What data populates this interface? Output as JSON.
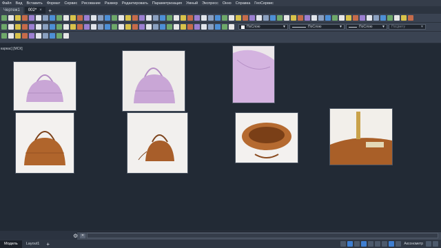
{
  "menubar": {
    "items": [
      "Файл",
      "Вид",
      "Вставить",
      "Формат",
      "Сервис",
      "Рисование",
      "Размер",
      "Редактировать",
      "Параметризация",
      "Умный",
      "Экспресс",
      "Окно",
      "Справка",
      "ГеоСервис"
    ]
  },
  "tabs": [
    {
      "label": "Чертеж1",
      "active": false
    },
    {
      "label": "002*",
      "active": true
    }
  ],
  "properties": {
    "color": "ПоСлою",
    "linetype": "ПоСлою",
    "lineweight": "ПоСлою",
    "plotstyle": "ПоЦвету"
  },
  "canvas": {
    "view_label": "каркас] [МСК]"
  },
  "images": [
    {
      "subject": "lilac leather handbag front view",
      "bag_color": "#c9a6d6"
    },
    {
      "subject": "lilac leather handbag angled view",
      "bag_color": "#c9a6d6"
    },
    {
      "subject": "lilac handbag close-up",
      "bag_color": "#d4b3e0"
    },
    {
      "subject": "brown leather handbag front view",
      "bag_color": "#b0652c"
    },
    {
      "subject": "brown handbag with shoulder strap",
      "bag_color": "#a85e2a"
    },
    {
      "subject": "brown handbag open interior top view",
      "bag_color": "#b56a30"
    },
    {
      "subject": "brown handbag clasp detail",
      "bag_color": "#a95f28"
    }
  ],
  "status": {
    "tabs": [
      "Модель",
      "Layout1"
    ],
    "annotation_scale": "Аксонометр"
  },
  "colors": {
    "accent": "#3f7fd1",
    "canvas": "#222a35",
    "toolbar": "#3a4352"
  }
}
